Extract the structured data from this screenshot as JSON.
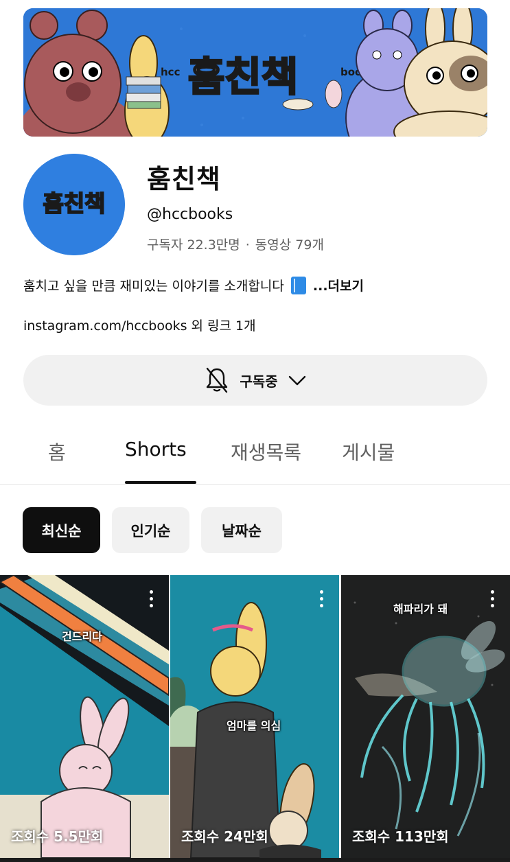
{
  "banner": {
    "title": "훔친책",
    "left_text": "hcc",
    "right_text": "books"
  },
  "channel": {
    "avatar_text": "훔친책",
    "name": "훔친책",
    "handle": "@hccbooks",
    "subscribers": "구독자 22.3만명",
    "separator": "·",
    "videos": "동영상 79개",
    "description": "훔치고 싶을 만큼 재미있는 이야기를 소개합니다",
    "more": "...더보기",
    "links": "instagram.com/hccbooks 외 링크 1개"
  },
  "subscribe": {
    "label": "구독중",
    "bell_icon": "bell-off-icon",
    "chevron_icon": "chevron-down-icon"
  },
  "tabs": [
    {
      "label": "홈"
    },
    {
      "label": "Shorts",
      "active": true
    },
    {
      "label": "재생목록"
    },
    {
      "label": "게시물"
    }
  ],
  "chips": [
    {
      "label": "최신순",
      "active": true
    },
    {
      "label": "인기순"
    },
    {
      "label": "날짜순"
    }
  ],
  "shorts": [
    {
      "caption": "건드리다",
      "views": "조회수 5.5만회"
    },
    {
      "caption": "엄마를 의심",
      "views": "조회수 24만회"
    },
    {
      "caption": "해파리가 돼",
      "views": "조회수 113만회"
    }
  ],
  "colors": {
    "banner_bg": "#2e78d6",
    "avatar_bg": "#2f7fe0",
    "chip_active": "#0f0f0f",
    "chip_inactive": "#f1f1f1",
    "text_secondary": "#606060"
  }
}
